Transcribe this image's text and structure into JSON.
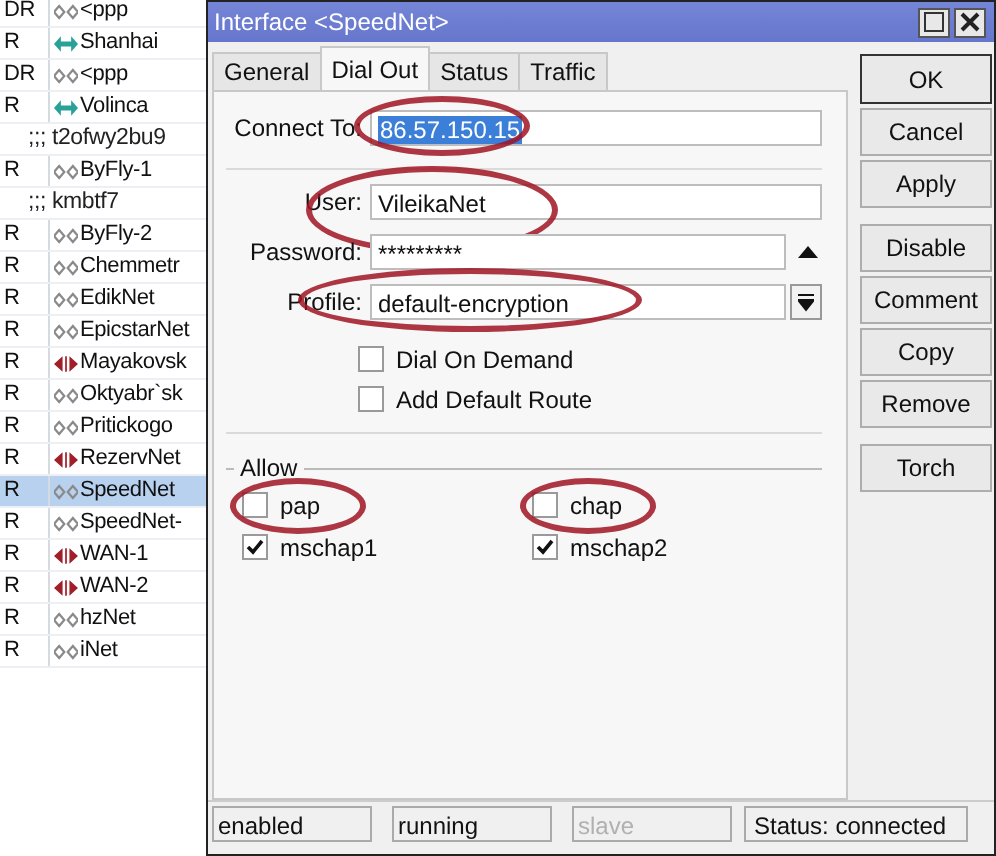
{
  "list": [
    {
      "kind": "pppoe",
      "flag": "DR",
      "name": "<ppp",
      "selected": false
    },
    {
      "kind": "ovpn",
      "flag": "R",
      "name": "Shanhai",
      "selected": false
    },
    {
      "kind": "pppoe",
      "flag": "DR",
      "name": "<ppp",
      "selected": false
    },
    {
      "kind": "ovpn",
      "flag": "R",
      "name": "Volinca",
      "selected": false
    },
    {
      "kind": "comment",
      "text": ";;; t2ofwy2bu9"
    },
    {
      "kind": "pppoe",
      "flag": "R",
      "name": "ByFly-1",
      "selected": false
    },
    {
      "kind": "comment",
      "text": ";;; kmbtf7"
    },
    {
      "kind": "pppoe",
      "flag": "R",
      "name": "ByFly-2",
      "selected": false
    },
    {
      "kind": "pppoe",
      "flag": "R",
      "name": "Chemmetr",
      "selected": false
    },
    {
      "kind": "pppoe",
      "flag": "R",
      "name": "EdikNet",
      "selected": false
    },
    {
      "kind": "pppoe",
      "flag": "R",
      "name": "EpicstarNet",
      "selected": false
    },
    {
      "kind": "l2tp",
      "flag": "R",
      "name": "Mayakovsk",
      "selected": false
    },
    {
      "kind": "pppoe",
      "flag": "R",
      "name": "Oktyabr`sk",
      "selected": false
    },
    {
      "kind": "pppoe",
      "flag": "R",
      "name": "Pritickogo",
      "selected": false
    },
    {
      "kind": "l2tp",
      "flag": "R",
      "name": "RezervNet",
      "selected": false
    },
    {
      "kind": "pppoe",
      "flag": "R",
      "name": "SpeedNet",
      "selected": true
    },
    {
      "kind": "pppoe",
      "flag": "R",
      "name": "SpeedNet-",
      "selected": false
    },
    {
      "kind": "l2tp",
      "flag": "R",
      "name": "WAN-1",
      "selected": false
    },
    {
      "kind": "l2tp",
      "flag": "R",
      "name": "WAN-2",
      "selected": false
    },
    {
      "kind": "pppoe",
      "flag": "R",
      "name": "hzNet",
      "selected": false
    },
    {
      "kind": "pppoe",
      "flag": "R",
      "name": "iNet",
      "selected": false
    }
  ],
  "window": {
    "title": "Interface <SpeedNet>"
  },
  "tabs": [
    {
      "label": "General",
      "selected": false
    },
    {
      "label": "Dial Out",
      "selected": true
    },
    {
      "label": "Status",
      "selected": false
    },
    {
      "label": "Traffic",
      "selected": false
    }
  ],
  "connect_to": {
    "label": "Connect To:",
    "value": "86.57.150.15",
    "selected": true,
    "circled": true
  },
  "user": {
    "label": "User:",
    "value": "VileikaNet",
    "circled": true
  },
  "password": {
    "label": "Password:",
    "value": "*********"
  },
  "profile": {
    "label": "Profile:",
    "value": "default-encryption",
    "circled": true
  },
  "options": [
    {
      "label": "Dial On Demand",
      "checked": false
    },
    {
      "label": "Add Default Route",
      "checked": false
    }
  ],
  "allow": {
    "title": "Allow",
    "items": [
      {
        "label": "pap",
        "checked": false,
        "circled": true
      },
      {
        "label": "chap",
        "checked": false,
        "circled": true
      },
      {
        "label": "mschap1",
        "checked": true,
        "circled": false
      },
      {
        "label": "mschap2",
        "checked": true,
        "circled": false
      }
    ]
  },
  "buttons": [
    "OK",
    "Cancel",
    "Apply",
    "Disable",
    "Comment",
    "Copy",
    "Remove",
    "Torch"
  ],
  "status_bar": [
    {
      "text": "enabled",
      "disabled": false
    },
    {
      "text": "running",
      "disabled": false
    },
    {
      "text": "slave",
      "disabled": true
    },
    {
      "text": "Status: connected",
      "disabled": false
    }
  ]
}
